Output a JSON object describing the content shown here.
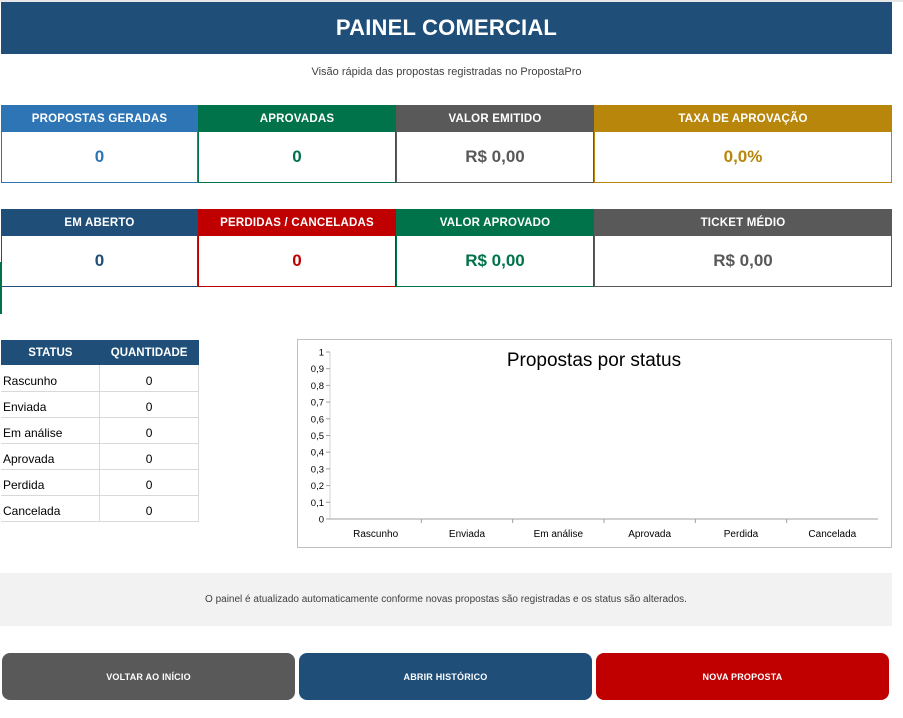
{
  "header": {
    "title": "PAINEL COMERCIAL"
  },
  "subtitle": "Visão rápida das propostas registradas no PropostaPro",
  "kpis_row1": [
    {
      "label": "PROPOSTAS GERADAS",
      "value": "0",
      "color": "#2e75b6",
      "text_color": "#2e75b6"
    },
    {
      "label": "APROVADAS",
      "value": "0",
      "color": "#00734a",
      "text_color": "#00734a"
    },
    {
      "label": "VALOR EMITIDO",
      "value": "R$ 0,00",
      "color": "#595959",
      "text_color": "#595959"
    },
    {
      "label": "TAXA DE APROVAÇÃO",
      "value": "0,0%",
      "color": "#b8860b",
      "text_color": "#b8860b"
    }
  ],
  "kpis_row2": [
    {
      "label": "EM ABERTO",
      "value": "0",
      "color": "#1f4e79",
      "text_color": "#1f4e79"
    },
    {
      "label": "PERDIDAS / CANCELADAS",
      "value": "0",
      "color": "#c00000",
      "text_color": "#c00000"
    },
    {
      "label": "VALOR APROVADO",
      "value": "R$ 0,00",
      "color": "#00734a",
      "text_color": "#00734a"
    },
    {
      "label": "TICKET MÉDIO",
      "value": "R$ 0,00",
      "color": "#595959",
      "text_color": "#595959"
    }
  ],
  "status_table": {
    "headers": [
      "STATUS",
      "QUANTIDADE"
    ],
    "rows": [
      {
        "status": "Rascunho",
        "qty": "0"
      },
      {
        "status": "Enviada",
        "qty": "0"
      },
      {
        "status": "Em análise",
        "qty": "0"
      },
      {
        "status": "Aprovada",
        "qty": "0"
      },
      {
        "status": "Perdida",
        "qty": "0"
      },
      {
        "status": "Cancelada",
        "qty": "0"
      }
    ]
  },
  "chart_data": {
    "type": "bar",
    "title": "Propostas por status",
    "categories": [
      "Rascunho",
      "Enviada",
      "Em análise",
      "Aprovada",
      "Perdida",
      "Cancelada"
    ],
    "values": [
      0,
      0,
      0,
      0,
      0,
      0
    ],
    "ylim": [
      0,
      1
    ],
    "yticks": [
      "0",
      "0,1",
      "0,2",
      "0,3",
      "0,4",
      "0,5",
      "0,6",
      "0,7",
      "0,8",
      "0,9",
      "1"
    ],
    "xlabel": "",
    "ylabel": "",
    "grid": false,
    "bar_color": "#1f4e79"
  },
  "note": "O painel é atualizado automaticamente conforme novas propostas são registradas e os status são alterados.",
  "buttons": {
    "home": "VOLTAR AO INÍCIO",
    "history": "ABRIR HISTÓRICO",
    "new": "NOVA PROPOSTA"
  }
}
